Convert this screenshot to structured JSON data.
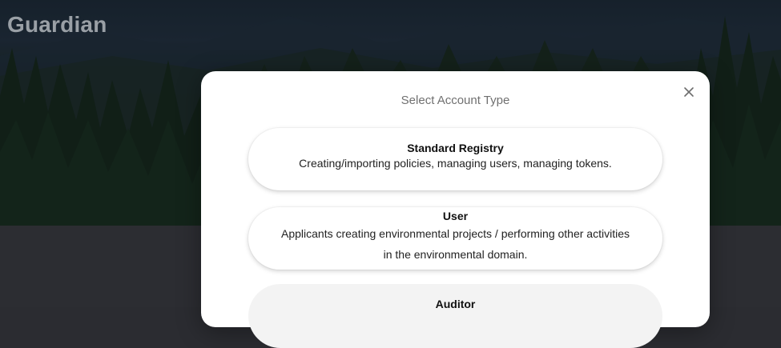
{
  "app": {
    "brand": "Guardian"
  },
  "colors": {
    "modal_bg": "#ffffff",
    "brand_text": "#9aa0a6",
    "title_text": "#707070"
  },
  "modal": {
    "title": "Select Account Type",
    "close_icon": "close-icon",
    "options": [
      {
        "name": "Standard Registry",
        "description": "Creating/importing policies, managing users, managing tokens."
      },
      {
        "name": "User",
        "description": "Applicants creating environmental projects / performing other activities in the environmental domain."
      },
      {
        "name": "Auditor",
        "description": ""
      }
    ]
  }
}
